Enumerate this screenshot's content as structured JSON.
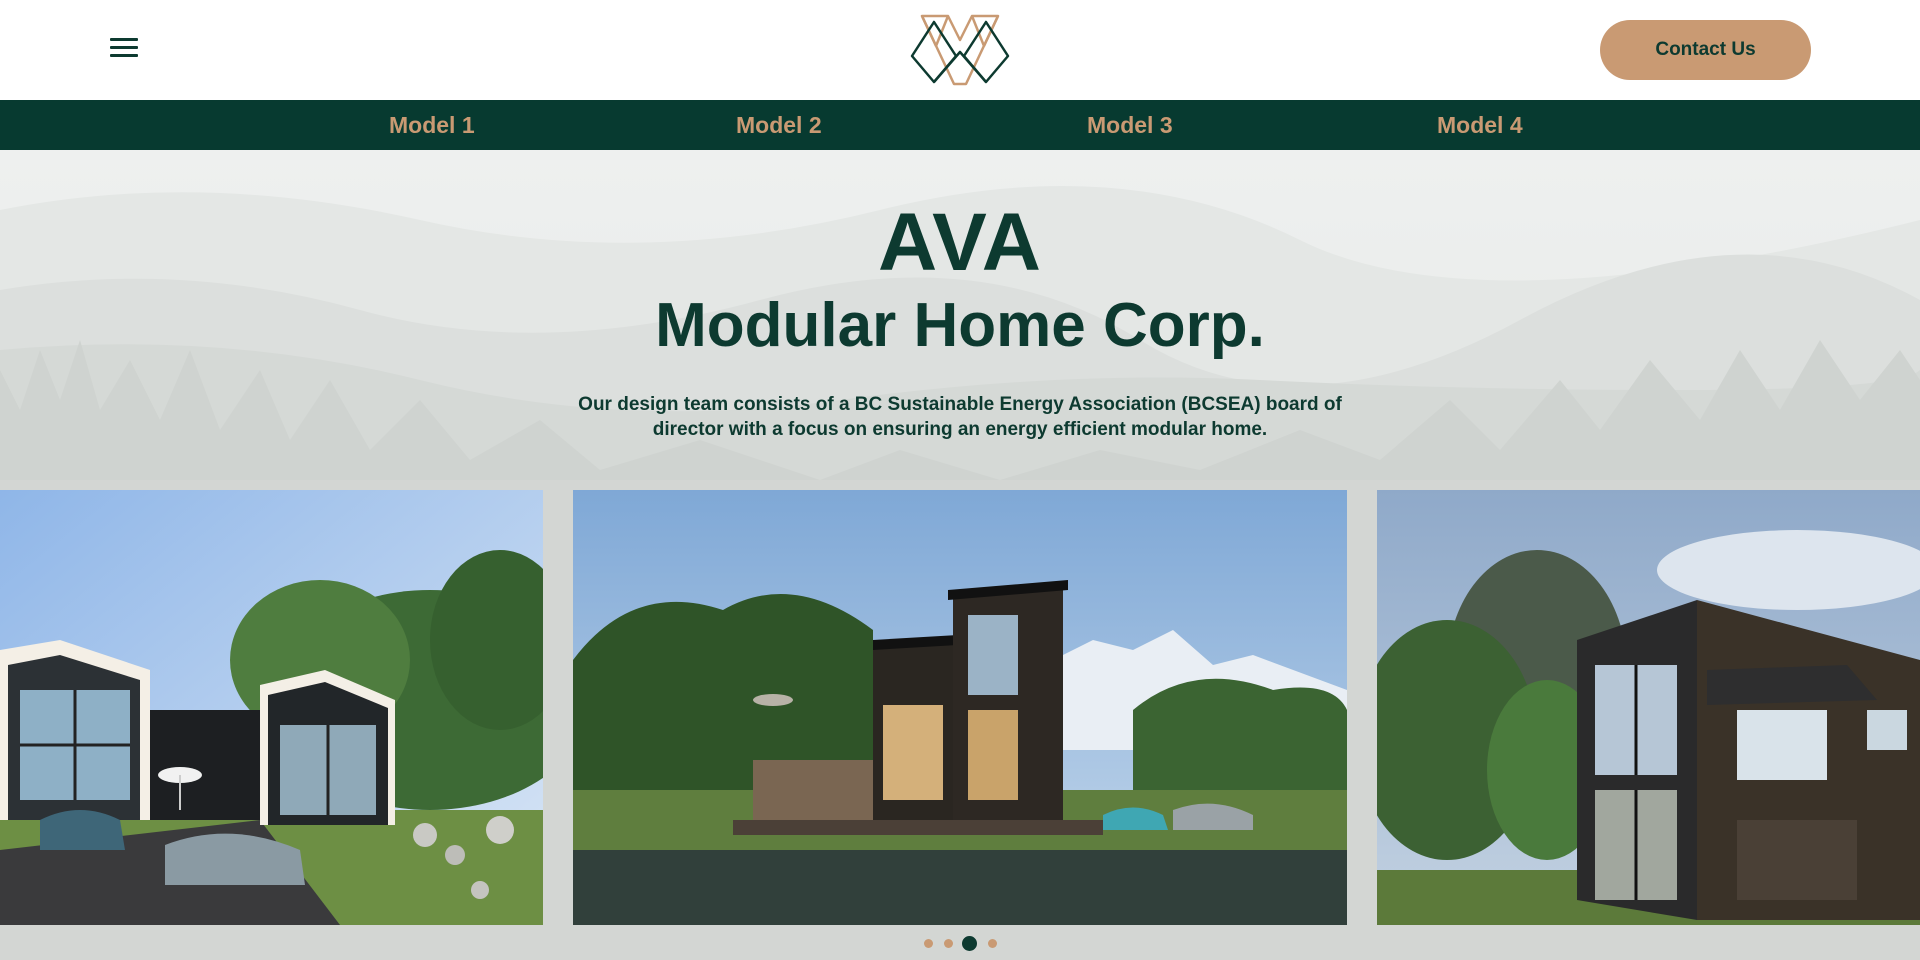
{
  "header": {
    "menu_icon": "hamburger-menu-icon",
    "logo_icon": "mountain-triangles-logo",
    "contact_label": "Contact Us"
  },
  "nav": {
    "items": [
      {
        "label": "Model 1"
      },
      {
        "label": "Model 2"
      },
      {
        "label": "Model 3"
      },
      {
        "label": "Model 4"
      }
    ]
  },
  "hero": {
    "title": "AVA",
    "subtitle": "Modular Home Corp.",
    "description": "Our design team consists of a BC Sustainable Energy Association (BCSEA) board of director with a focus on ensuring an energy efficient modular home."
  },
  "carousel": {
    "slide_count": 4,
    "active_index": 2
  },
  "colors": {
    "brand_dark": "#0d3a30",
    "nav_bg": "#073a30",
    "accent": "#c99a73"
  }
}
